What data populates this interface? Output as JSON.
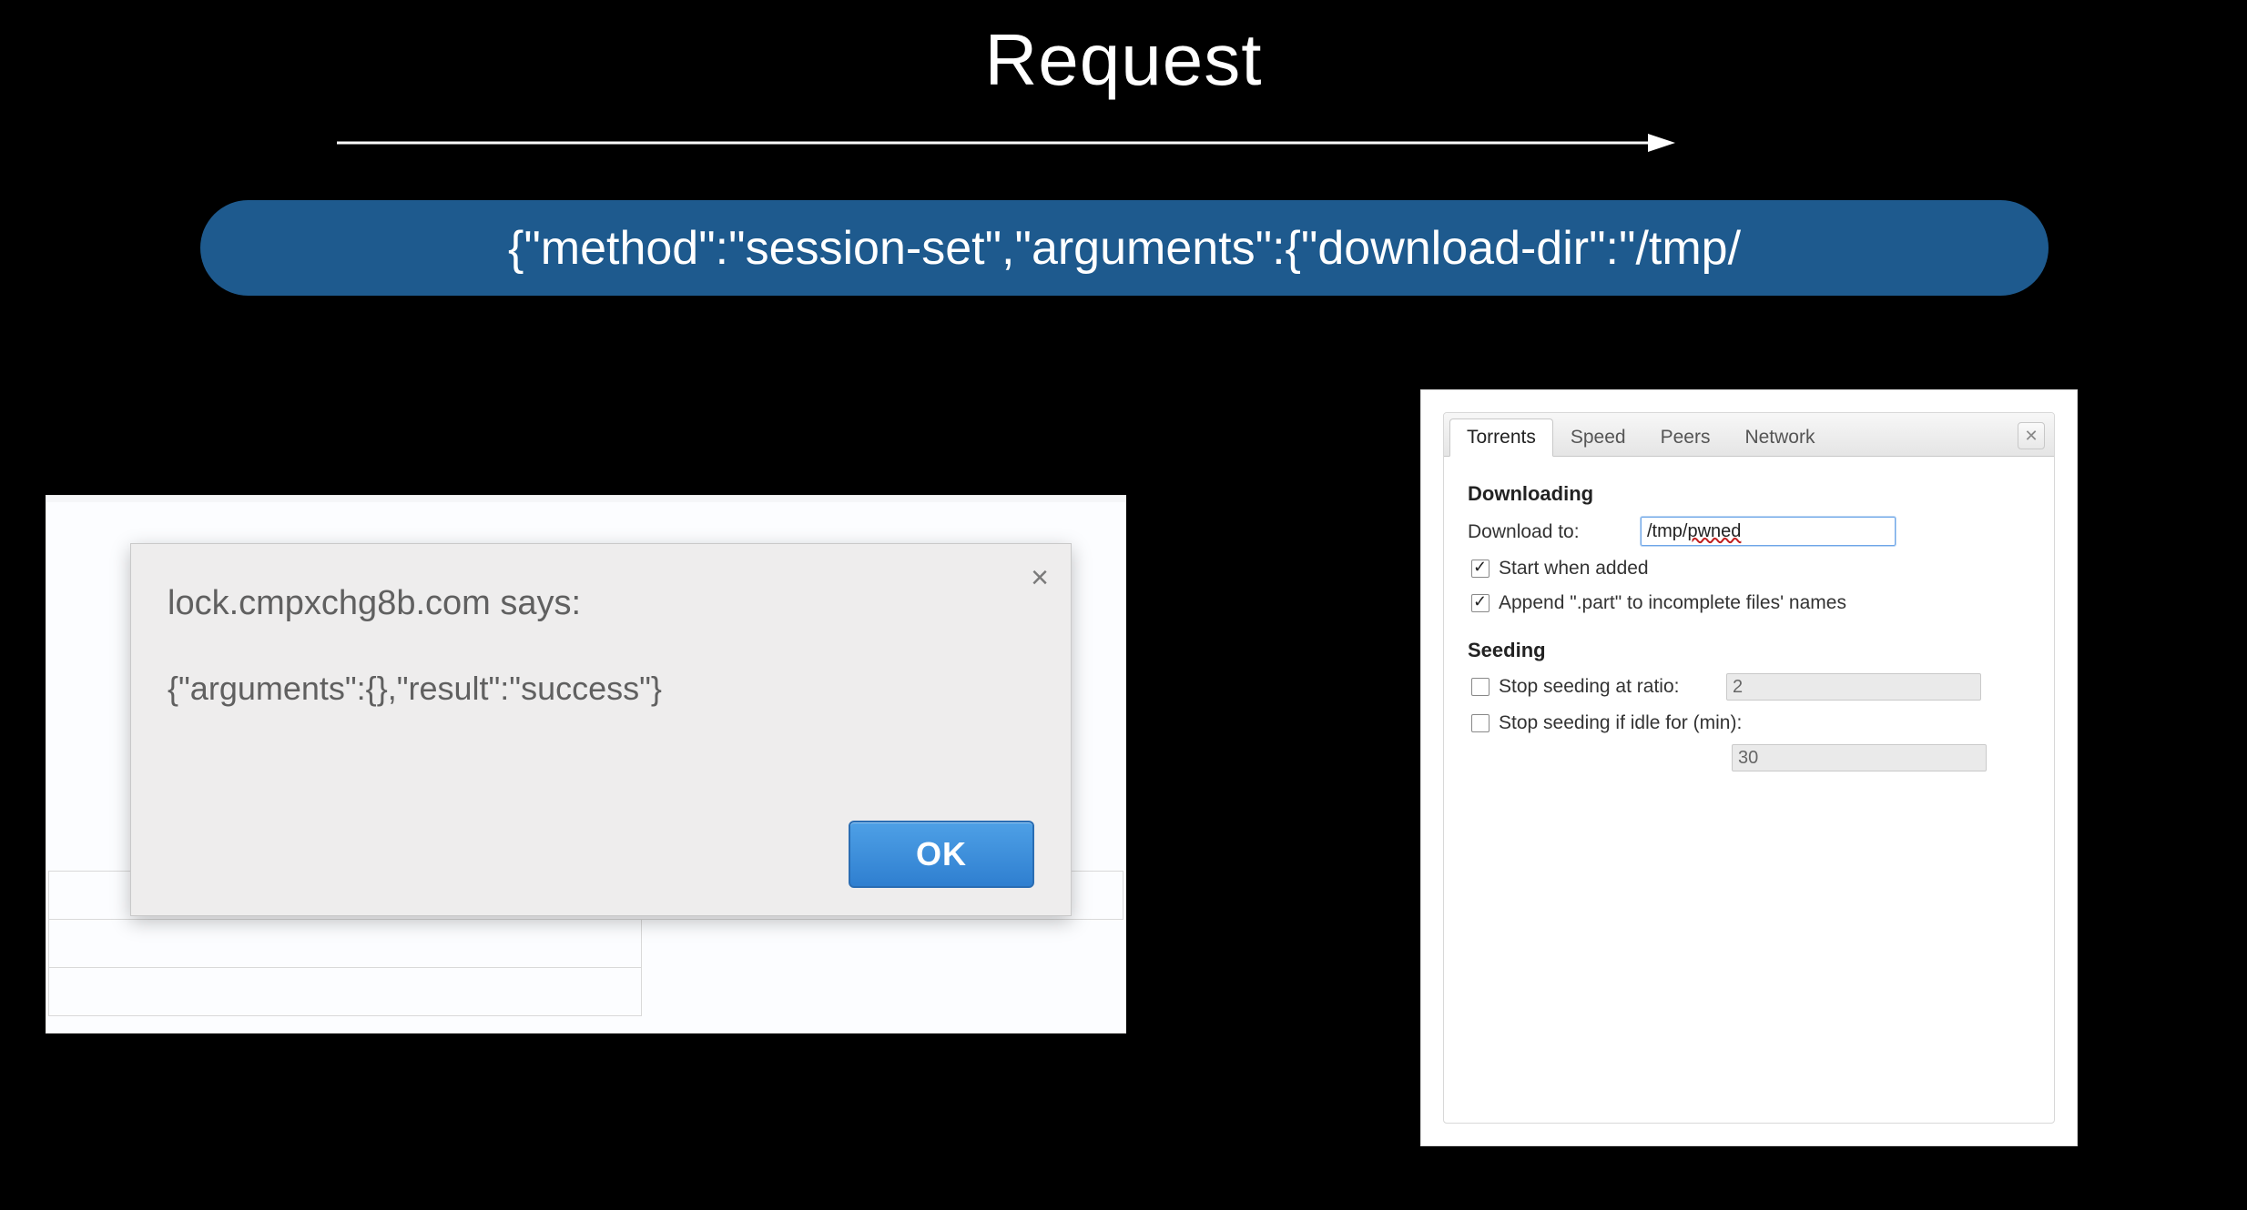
{
  "title": "Request",
  "banner_text": "{\"method\":\"session-set\",\"arguments\":{\"download-dir\":\"/tmp/",
  "alert": {
    "domain": "lock.cmpxchg8b.com says:",
    "body": "{\"arguments\":{},\"result\":\"success\"}",
    "ok": "OK"
  },
  "prefs": {
    "tabs": [
      "Torrents",
      "Speed",
      "Peers",
      "Network"
    ],
    "active_tab": 0,
    "downloading_heading": "Downloading",
    "download_to_label": "Download to:",
    "download_to_value_prefix": "/tmp/",
    "download_to_value_suffix": "pwned",
    "start_when_added": {
      "label": "Start when added",
      "checked": true
    },
    "append_part": {
      "label": "Append \".part\" to incomplete files' names",
      "checked": true
    },
    "seeding_heading": "Seeding",
    "stop_ratio": {
      "label": "Stop seeding at ratio:",
      "checked": false,
      "value": "2"
    },
    "stop_idle": {
      "label": "Stop seeding if idle for (min):",
      "checked": false,
      "value": "30"
    }
  }
}
